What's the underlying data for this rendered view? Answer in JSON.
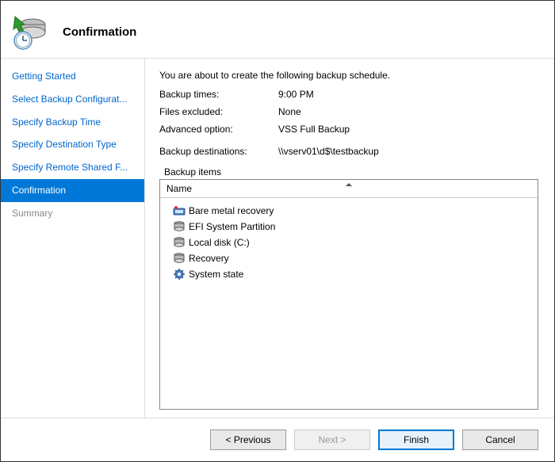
{
  "header": {
    "title": "Confirmation"
  },
  "sidebar": {
    "items": [
      {
        "label": "Getting Started",
        "state": "link"
      },
      {
        "label": "Select Backup Configurat...",
        "state": "link"
      },
      {
        "label": "Specify Backup Time",
        "state": "link"
      },
      {
        "label": "Specify Destination Type",
        "state": "link"
      },
      {
        "label": "Specify Remote Shared F...",
        "state": "link"
      },
      {
        "label": "Confirmation",
        "state": "selected"
      },
      {
        "label": "Summary",
        "state": "disabled"
      }
    ]
  },
  "content": {
    "intro": "You are about to create the following backup schedule.",
    "rows": [
      {
        "label": "Backup times:",
        "value": "9:00 PM"
      },
      {
        "label": "Files excluded:",
        "value": "None"
      },
      {
        "label": "Advanced option:",
        "value": "VSS Full Backup"
      }
    ],
    "dest_label": "Backup destinations:",
    "dest_value": "\\\\vserv01\\d$\\testbackup",
    "items_label": "Backup items",
    "column_header": "Name",
    "items": [
      {
        "icon": "recovery-icon",
        "label": "Bare metal recovery"
      },
      {
        "icon": "disk-icon",
        "label": "EFI System Partition"
      },
      {
        "icon": "disk-icon",
        "label": "Local disk (C:)"
      },
      {
        "icon": "disk-icon",
        "label": "Recovery"
      },
      {
        "icon": "gear-icon",
        "label": "System state"
      }
    ]
  },
  "footer": {
    "previous": "< Previous",
    "next": "Next >",
    "finish": "Finish",
    "cancel": "Cancel"
  }
}
